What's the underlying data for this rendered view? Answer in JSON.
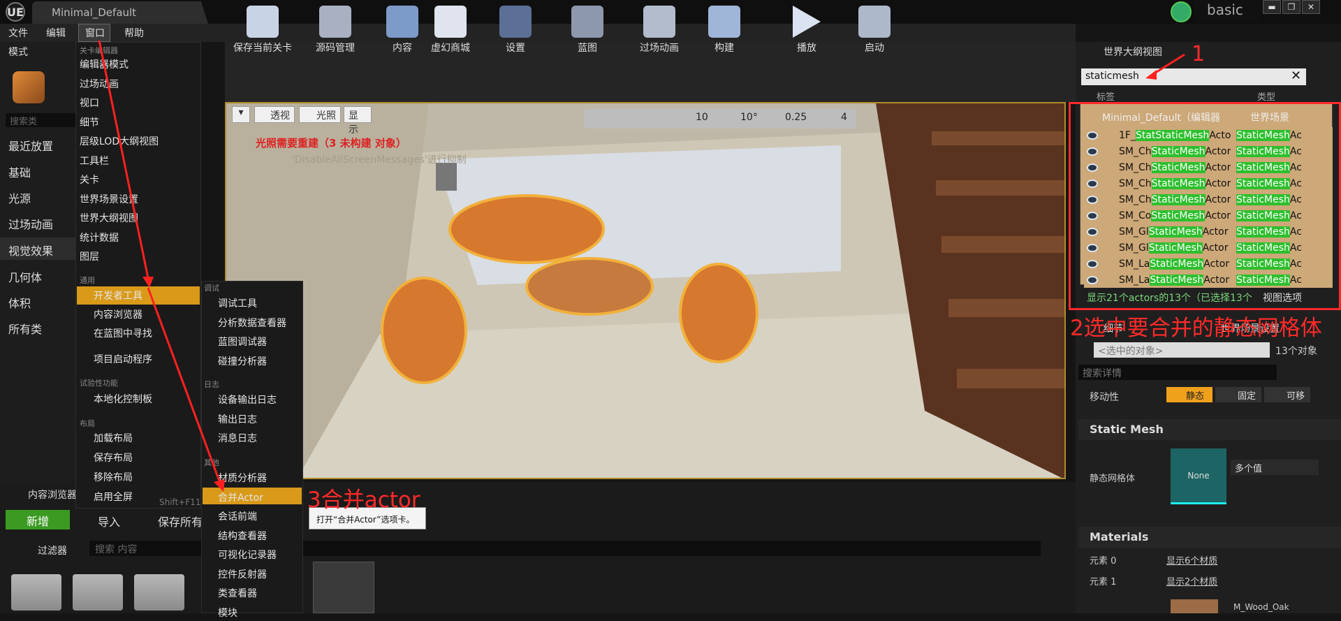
{
  "window": {
    "project_tab": "Minimal_Default",
    "profile": "basic",
    "logo": "UE"
  },
  "menubar": [
    "文件",
    "编辑",
    "窗口",
    "帮助"
  ],
  "left_panel": {
    "mode_label": "模式",
    "search_placeholder": "搜索类",
    "items": [
      "最近放置",
      "基础",
      "光源",
      "过场动画",
      "视觉效果",
      "几何体",
      "体积",
      "所有类"
    ]
  },
  "toolbar": {
    "buttons": [
      "保存当前关卡",
      "源码管理",
      "内容",
      "虚幻商城",
      "设置",
      "蓝图",
      "过场动画",
      "构建",
      "播放",
      "启动"
    ]
  },
  "viewport": {
    "perspective": "透视",
    "lit": "光照",
    "show": "显示",
    "warning": "光照需要重建（3 未构建 对象）",
    "suppress": "'DisableAllScreenMessages'进行抑制",
    "snap_grid": "10",
    "snap_angle": "10°",
    "snap_scale": "0.25",
    "cam_speed": "4"
  },
  "window_menu": {
    "sections": {
      "level_editor": "关卡编辑器",
      "general": "通用",
      "experimental": "试验性功能",
      "layout": "布局"
    },
    "level_items": [
      "编辑器模式",
      "过场动画",
      "视口",
      "细节",
      "层级LOD大纲视图",
      "工具栏",
      "关卡",
      "世界场景设置",
      "世界大纲视图",
      "统计数据",
      "图层"
    ],
    "general_items": [
      "开发者工具",
      "内容浏览器",
      "在蓝图中寻找",
      "项目启动程序"
    ],
    "experimental_items": [
      "本地化控制板"
    ],
    "layout_items": [
      "加载布局",
      "保存布局",
      "移除布局",
      "启用全屏"
    ],
    "fullscreen_shortcut": "Shift+F11"
  },
  "dev_menu": {
    "sections": {
      "debug": "调试",
      "log": "日志",
      "other": "其他"
    },
    "debug_items": [
      "调试工具",
      "分析数据查看器",
      "蓝图调试器",
      "碰撞分析器"
    ],
    "log_items": [
      "设备输出日志",
      "输出日志",
      "消息日志"
    ],
    "other_items": [
      "材质分析器",
      "合并Actor",
      "会话前端",
      "结构查看器",
      "可视化记录器",
      "控件反射器",
      "类查看器",
      "模块"
    ],
    "tooltip": "打开“合并Actor”选项卡。"
  },
  "annotations": {
    "a1": "1",
    "a2": "2选中要合并的静态网格体",
    "a3": "3合并actor"
  },
  "outliner": {
    "title": "世界大纲视图",
    "search_value": "staticmesh",
    "col_label": "标签",
    "col_type": "类型",
    "root_label": "Minimal_Default（编辑器",
    "root_type": "世界场景",
    "rows": [
      {
        "pre": "1F_",
        "hl": "StatStaticMesh",
        "post": "Actor",
        "t": "StaticMesh",
        "t2": "Ac"
      },
      {
        "pre": "SM_Ch",
        "hl": "StaticMesh",
        "post": "Actor",
        "t": "StaticMesh",
        "t2": "Ac"
      },
      {
        "pre": "SM_Ch",
        "hl": "StaticMesh",
        "post": "Actor",
        "t": "StaticMesh",
        "t2": "Ac"
      },
      {
        "pre": "SM_Ch",
        "hl": "StaticMesh",
        "post": "Actor",
        "t": "StaticMesh",
        "t2": "Ac"
      },
      {
        "pre": "SM_Ch",
        "hl": "StaticMesh",
        "post": "Actor",
        "t": "StaticMesh",
        "t2": "Ac"
      },
      {
        "pre": "SM_Co",
        "hl": "StaticMesh",
        "post": "Actor",
        "t": "StaticMesh",
        "t2": "Ac"
      },
      {
        "pre": "SM_Gl",
        "hl": "StaticMesh",
        "post": "Actor",
        "t": "StaticMesh",
        "t2": "Ac"
      },
      {
        "pre": "SM_Gl",
        "hl": "StaticMesh",
        "post": "Actor",
        "t": "StaticMesh",
        "t2": "Ac"
      },
      {
        "pre": "SM_La",
        "hl": "StaticMesh",
        "post": "Actor",
        "t": "StaticMesh",
        "t2": "Ac"
      },
      {
        "pre": "SM_La",
        "hl": "StaticMesh",
        "post": "Actor",
        "t": "StaticMesh",
        "t2": "Ac"
      }
    ],
    "status": "显示21个actors的13个（已选择13个",
    "view_options": "视图选项"
  },
  "details": {
    "tab_details": "细节",
    "tab_world": "世界场景设置",
    "selected_placeholder": "<选中的对象>",
    "selected_count": "13个对象",
    "search_placeholder": "搜索详情",
    "mobility_label": "移动性",
    "mobility": [
      "静态",
      "固定",
      "可移"
    ],
    "static_mesh_section": "Static Mesh",
    "static_mesh_label": "静态网格体",
    "mesh_value": "None",
    "multi_value": "多个值",
    "materials_section": "Materials",
    "element0": "元素 0",
    "element1": "元素 1",
    "element0_value": "显示6个材质",
    "element1_value": "显示2个材质",
    "material_name": "M_Wood_Oak"
  },
  "content_browser": {
    "tab": "内容浏览器",
    "new": "新增",
    "import": "导入",
    "save_all": "保存所有",
    "filter": "过滤器",
    "search_placeholder": "搜索 内容"
  }
}
